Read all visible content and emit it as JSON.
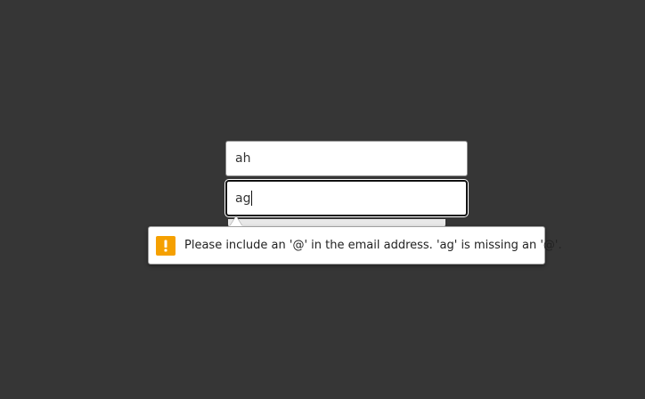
{
  "form": {
    "first_field_value": "ah",
    "email_field_value": "ag"
  },
  "validation": {
    "message": "Please include an '@' in the email address. 'ag' is missing an '@'.",
    "icon": "warning-icon",
    "icon_color": "#f5a000"
  },
  "colors": {
    "background": "#363636",
    "field_background": "#ffffff"
  }
}
